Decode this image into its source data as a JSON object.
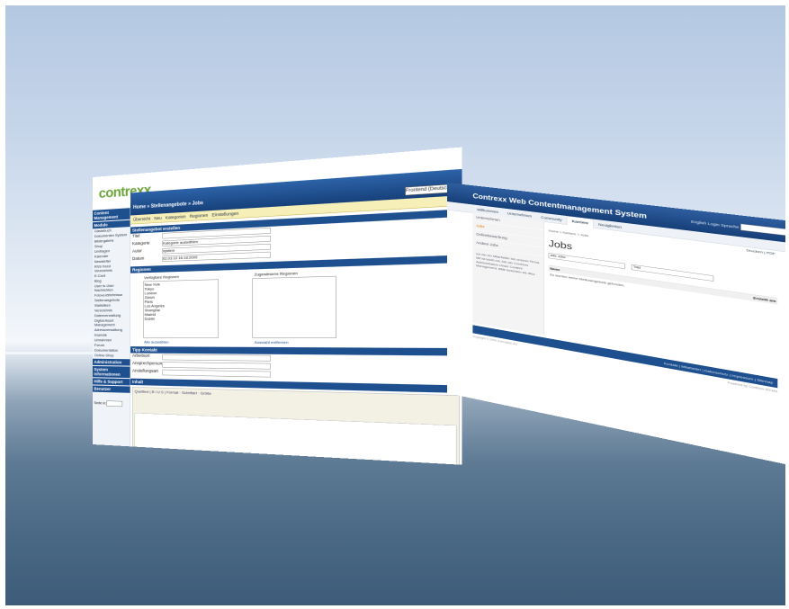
{
  "left_window": {
    "logo": "contrexx",
    "sidebar": {
      "sections": [
        {
          "title": "Content Management",
          "items": []
        },
        {
          "title": "Module",
          "items": [
            "Gästebuch",
            "Dokumenten System",
            "Bildergalerie",
            "Shop",
            "Umfragen",
            "Kalender",
            "Newsletter",
            "RSS Feed Verzeichnis",
            "E-Card",
            "Blog",
            "User to User Nachrichten",
            "Fotoverzeichnisse",
            "Stellenangebote",
            "Statistiken",
            "Verzeichnis",
            "Datenverwaltung",
            "Digital Asset Management",
            "Adressverwaltung",
            "Inserate",
            "Umrahmen",
            "Forum",
            "Dokumentation",
            "Online-Shop"
          ]
        },
        {
          "title": "Administration",
          "items": []
        },
        {
          "title": "System Informationen",
          "items": []
        },
        {
          "title": "Hilfe & Support",
          "items": []
        },
        {
          "title": "Benutzer",
          "items": []
        }
      ],
      "select_label": "Seite in:"
    },
    "breadcrumb": "Home » Stellenangebote » Jobs",
    "language_select": "Frontend (Deutsch)",
    "tabs": [
      "Übersicht",
      "Neu",
      "Kategorien",
      "Regionen",
      "Einstellungen"
    ],
    "sections": {
      "job": "Stellenangebot erstellen",
      "regions": "Regionen",
      "contact": "Tipp Kontakt",
      "content": "Inhalt"
    },
    "fields": [
      {
        "label": "Titel",
        "value": ""
      },
      {
        "label": "Kategorie",
        "value": "Kategorie auswählen"
      },
      {
        "label": "Autor",
        "value": "system"
      },
      {
        "label": "Datum",
        "value": "02.03.10 16:18:2009"
      }
    ],
    "regions": {
      "available_label": "Verfügbare Regionen",
      "assigned_label": "Zugewiesene Regionen",
      "available": [
        "New York",
        "Tokyo",
        "London",
        "Zürich",
        "Paris",
        "Los Angeles",
        "Shanghai",
        "Madrid",
        "Dublin"
      ],
      "select_all": "Alle auswählen",
      "remove_all": "Auswahl entfernen"
    },
    "contact_fields": [
      "Arbeitsort",
      "Ansprechperson",
      "Anstellungsart"
    ],
    "editor": {
      "toolbar1": "Quelltext | B I U S | Format · Schriftart · Größe",
      "format": "Format",
      "font": "Schriftart",
      "size": "Größe"
    }
  },
  "right_window": {
    "site_title": "Contrexx Web Contentmanagement System",
    "top_links": "English  Login  Sprache",
    "nav": [
      "Willkommen",
      "Unternehmen",
      "Community",
      "Karriere",
      "Neuigkeiten"
    ],
    "active_nav": "Karriere",
    "left_nav": [
      "Unternehmen",
      "Jobs",
      "Onlinebewerbung",
      "Andere Jobs"
    ],
    "current_left_nav": "Jobs",
    "left_text": "Ich bin ein Mitarbeiter bei unserer Firma. Mit ist leicht ein Job der Contrexx Administration Unser Content Management. Bitte beachten sie dies.",
    "actions": "Drucken  |  PDF",
    "breadcrumb": "Home > Karriere > Jobs",
    "heading": "Jobs",
    "filters": [
      "Alle Jobs",
      "Titel"
    ],
    "results_header": "Name",
    "results_header_right": "Erstellt am",
    "no_results": "Es wurden keine Stellenangebote gefunden.",
    "footer": "Kontakt | Mitarbeiter | Datenschutz | Impressum | Sitemap",
    "copyright": "Copyright © 2009 Comvation AG",
    "credit": "Powered by Contrexx WCMS"
  }
}
